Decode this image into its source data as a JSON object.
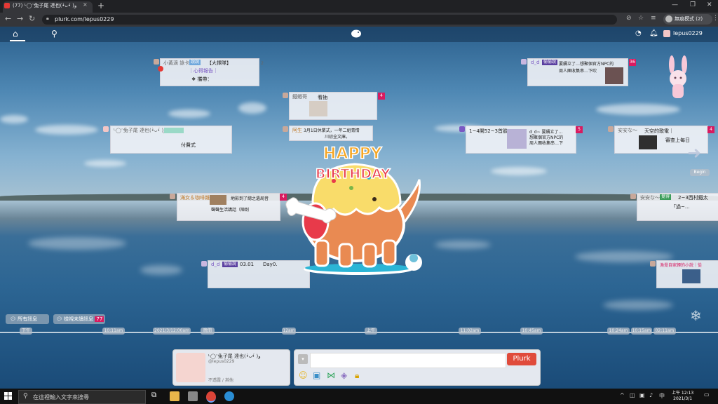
{
  "browser": {
    "tab_title": "(77) ᒡ◯ᵔ兔子尾 達也(•̀ᴗ•́ )و [lepus",
    "tab_close": "×",
    "new_tab": "+",
    "url": "plurk.com/lepus0229",
    "profile_label": "無痕模式 (2)",
    "window_controls": [
      "—",
      "❐",
      "✕"
    ]
  },
  "plurk_bar": {
    "username": "lepus0229"
  },
  "cards": [
    {
      "name": "小黃滴 詠卡",
      "qualifier": "說說",
      "text1": "【大擇隊】",
      "text2": "｜心得報告｜",
      "text3": "❖ 攜帶：",
      "count": "2"
    },
    {
      "name": "d_d",
      "qualifier": "偷偷說",
      "text1": "要續立了…想聚個官方NPC的",
      "text2": "周人團收集串…下吹",
      "count": "36"
    },
    {
      "name": "鐵蝦哥",
      "text1": "看抽",
      "count": "4"
    },
    {
      "name": "ᒡ◯ᵔ兔子尾 達也(•̀ᴗ•́ )و",
      "text1": "付費式",
      "count": ""
    },
    {
      "name": "阿生",
      "text1": "3月1日休業式，一年二組青情",
      "text2": "川初全文庫。",
      "count": ""
    },
    {
      "name": "",
      "text1": "1~4開52~3首臉",
      "text2": "d_d~ 要續立了…",
      "text3": "想聚個官方NPC的",
      "text4": "周人團收集串…下",
      "count": "5"
    },
    {
      "name": "安安な～",
      "text1": "天空的歌電｜",
      "text2": "審查上每日",
      "count": "4"
    },
    {
      "name": "滿女＆咖啡雜",
      "text1": "地影到了總之遺局音",
      "text2": "聲聲生活講話（陳劍",
      "count": "4"
    },
    {
      "name": "安安な～",
      "qualifier": "覺得",
      "text1": "2~3西村鐵太",
      "text2": "「過~...",
      "count": ""
    },
    {
      "name": "d_d",
      "qualifier": "偷偷說",
      "text1": "03.01",
      "text2": "Day0.",
      "count": "1"
    },
    {
      "name": "",
      "text1": "漁覺自家歸的小說｜從",
      "count": ""
    }
  ],
  "timeline": {
    "begin": "Begin",
    "ticks": [
      "下午",
      "10:11am",
      "2021/3/12:00am",
      "晚間",
      "12am",
      "上午",
      "11:02am",
      "10:45am",
      "10:24am",
      "10:15am",
      "02:11am"
    ]
  },
  "filters": {
    "all": "所有訊息",
    "unread": "檢視未讀訊息",
    "unread_count": "77"
  },
  "profile_card": {
    "name": "ᒡ◯ᵔ兔子尾 達也(•̀ᴗ•́ )و",
    "handle": "@lepus0229",
    "status": "不透露 / 其他"
  },
  "compose": {
    "placeholder": "",
    "plurk_button": "Plurk"
  },
  "sticker": {
    "text_happy": "HAPPY",
    "text_birthday": "BIRTHDAY"
  },
  "taskbar": {
    "search_placeholder": "在這裡輸入文字來搜尋",
    "time": "上午 12:13",
    "date": "2021/3/1"
  },
  "colors": {
    "plurk_red": "#e04b3b",
    "count_badge": "#d81b60",
    "qualifier": "#5a3fa0",
    "chrome_dark": "#202124"
  }
}
